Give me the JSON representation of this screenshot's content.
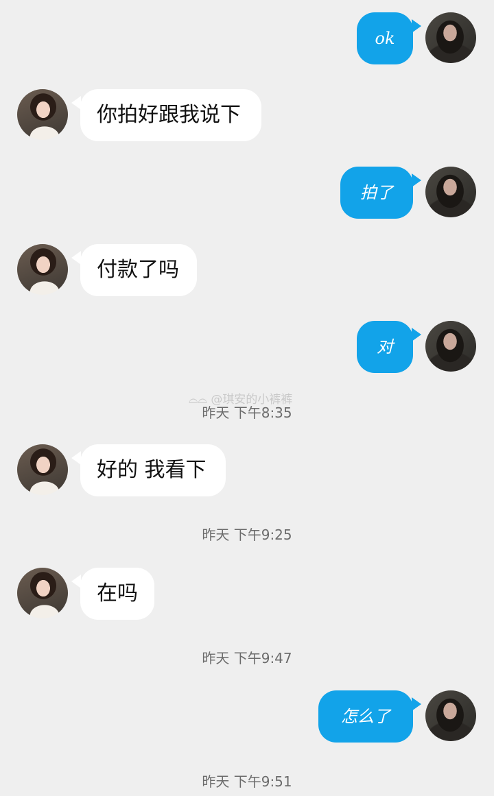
{
  "messages": [
    {
      "side": "me",
      "text": "ok"
    },
    {
      "side": "other",
      "text": "你拍好跟我说下"
    },
    {
      "side": "me",
      "text": "拍了"
    },
    {
      "side": "other",
      "text": "付款了吗"
    },
    {
      "side": "me",
      "text": "对"
    },
    {
      "side": "other",
      "text": "好的 我看下"
    },
    {
      "side": "other",
      "text": "在吗"
    },
    {
      "side": "me",
      "text": "怎么了"
    }
  ],
  "timestamps": [
    "昨天 下午8:35",
    "昨天 下午9:25",
    "昨天 下午9:47",
    "昨天 下午9:51"
  ],
  "watermark": "@琪安的小裤裤",
  "colors": {
    "background": "#efefef",
    "my_bubble": "#12a3e9",
    "other_bubble": "#ffffff"
  }
}
